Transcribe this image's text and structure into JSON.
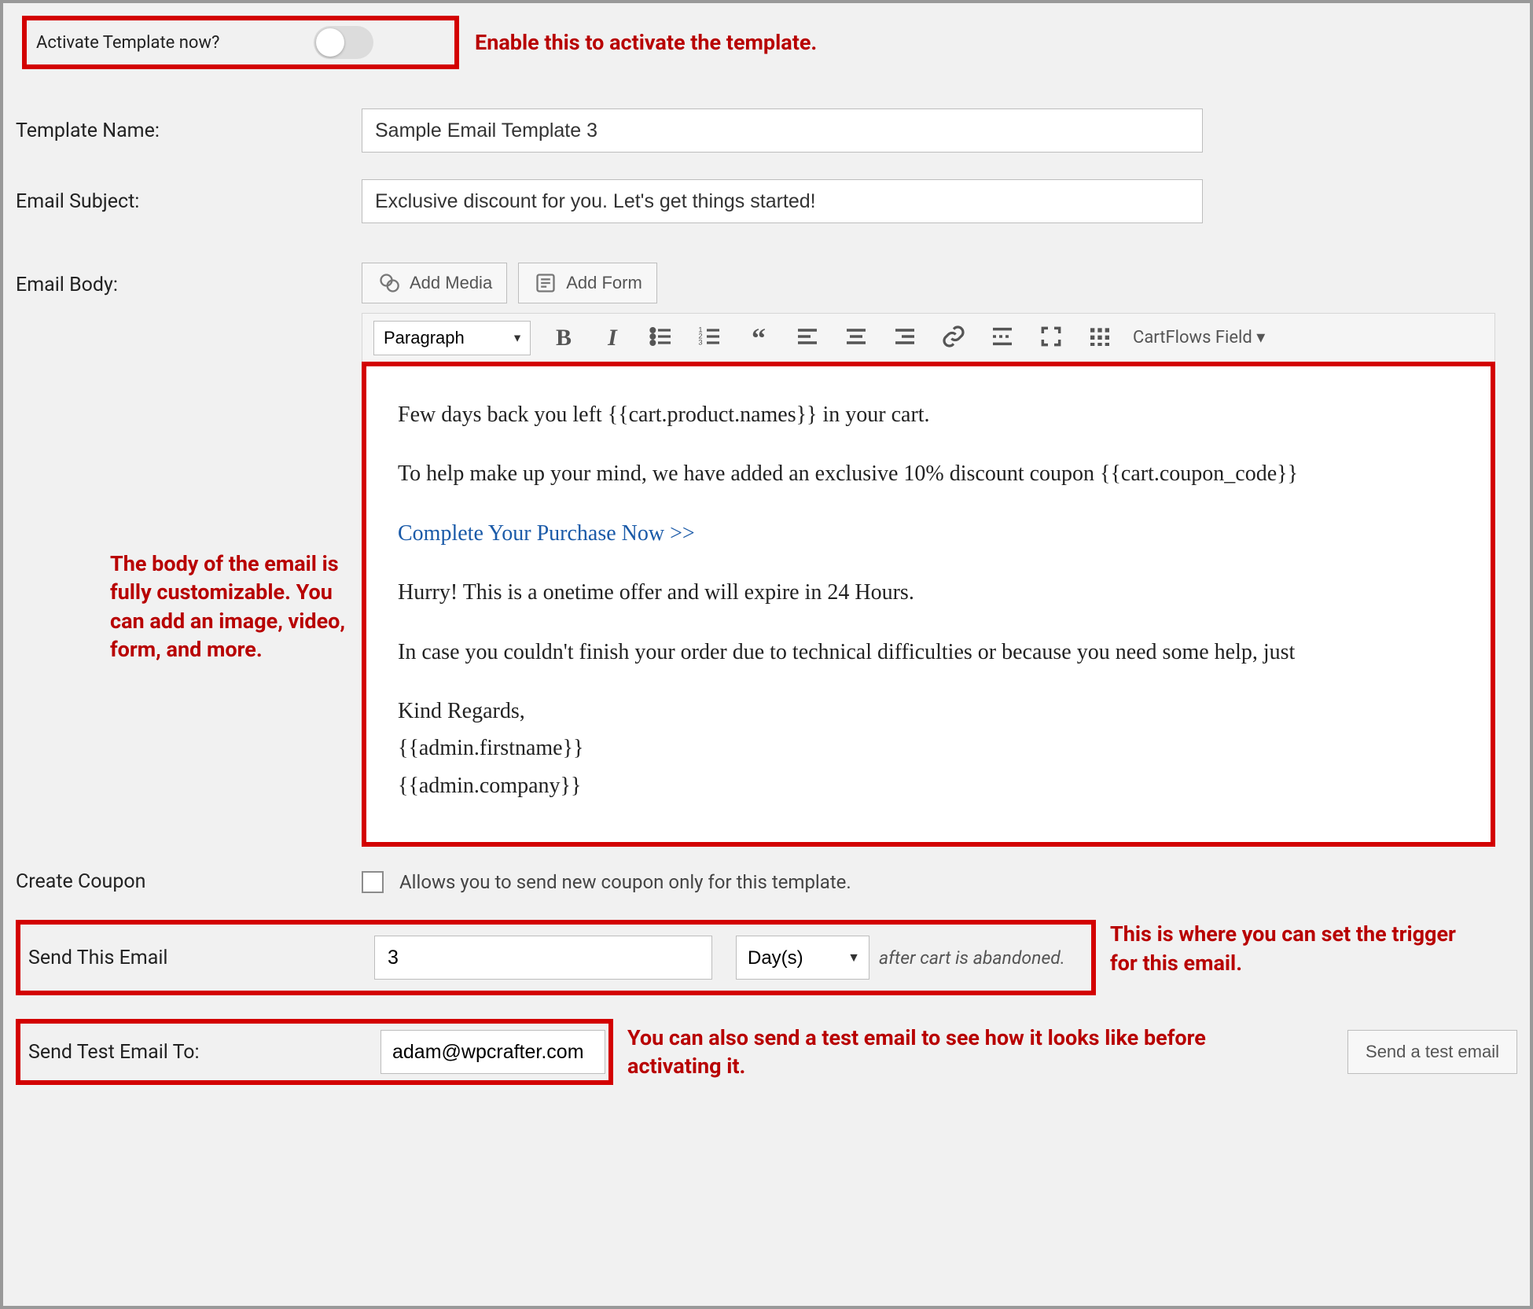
{
  "activate": {
    "label": "Activate Template now?",
    "annotation": "Enable this to activate the template."
  },
  "templateName": {
    "label": "Template Name:",
    "value": "Sample Email Template 3"
  },
  "emailSubject": {
    "label": "Email Subject:",
    "value": "Exclusive discount for you. Let's get things started!"
  },
  "emailBody": {
    "label": "Email Body:",
    "addMedia": "Add Media",
    "addForm": "Add Form",
    "formatSelect": "Paragraph",
    "cartflowsField": "CartFlows Field ▾",
    "annotation": "The body of the email is fully customizable. You can add an image, video, form, and more.",
    "content": {
      "l1": "Few days back you left {{cart.product.names}} in your cart.",
      "l2": "To help make up your mind, we have added an exclusive 10% discount coupon {{cart.coupon_code}}",
      "link": "Complete Your Purchase Now >>",
      "l3": "Hurry! This is a onetime offer and will expire in 24 Hours.",
      "l4": "In case you couldn't finish your order due to technical difficulties or because you need some help, just",
      "l5": "Kind Regards,",
      "l6": "{{admin.firstname}}",
      "l7": "{{admin.company}}"
    }
  },
  "createCoupon": {
    "label": "Create Coupon",
    "desc": "Allows you to send new coupon only for this template."
  },
  "sendThisEmail": {
    "label": "Send This Email",
    "value": "3",
    "unit": "Day(s)",
    "after": "after cart is abandoned.",
    "annotation": "This is where you can set the trigger for this email."
  },
  "sendTest": {
    "label": "Send Test Email To:",
    "value": "adam@wpcrafter.com",
    "button": "Send a test email",
    "annotation": "You can also send a test email to see how it looks like before activating it."
  }
}
